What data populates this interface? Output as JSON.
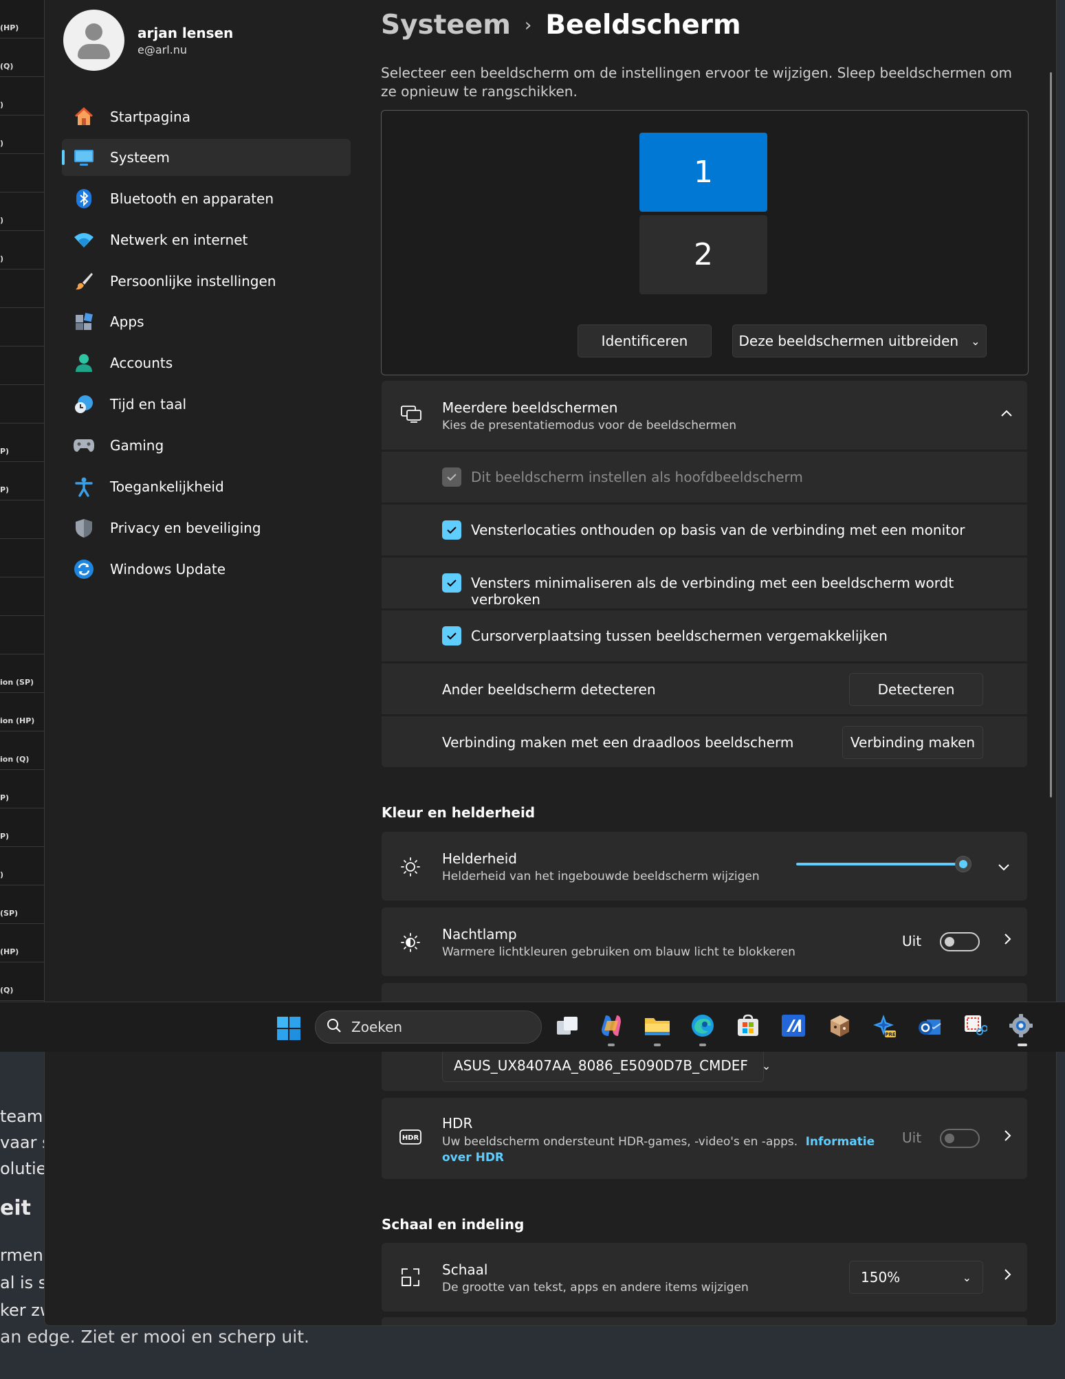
{
  "background": {
    "list_labels": [
      "(HP)",
      "(Q)",
      ")",
      ")",
      "",
      ")",
      ")",
      "",
      "",
      "",
      "",
      "P)",
      "P)",
      "",
      "",
      "",
      "",
      "ion (SP)",
      "ion (HP)",
      "ion (Q)",
      "P)",
      "P)",
      ")",
      "(SP)",
      "(HP)",
      "(Q)"
    ],
    "lines": [
      "team s",
      "vaar sp",
      "olutie",
      "eit",
      "rmen v",
      "al is sc",
      "ker zw"
    ],
    "edge_text": "an edge. Ziet er mooi en scherp uit."
  },
  "user": {
    "name": "arjan lensen",
    "email": "e@arl.nu"
  },
  "nav": [
    {
      "label": "Startpagina",
      "icon": "home-icon"
    },
    {
      "label": "Systeem",
      "icon": "system-icon",
      "active": true
    },
    {
      "label": "Bluetooth en apparaten",
      "icon": "bluetooth-icon"
    },
    {
      "label": "Netwerk en internet",
      "icon": "wifi-icon"
    },
    {
      "label": "Persoonlijke instellingen",
      "icon": "brush-icon"
    },
    {
      "label": "Apps",
      "icon": "apps-icon"
    },
    {
      "label": "Accounts",
      "icon": "accounts-icon"
    },
    {
      "label": "Tijd en taal",
      "icon": "time-language-icon"
    },
    {
      "label": "Gaming",
      "icon": "gamepad-icon"
    },
    {
      "label": "Toegankelijkheid",
      "icon": "accessibility-icon"
    },
    {
      "label": "Privacy en beveiliging",
      "icon": "shield-icon"
    },
    {
      "label": "Windows Update",
      "icon": "update-icon"
    }
  ],
  "breadcrumb": {
    "parent": "Systeem",
    "separator": "›",
    "current": "Beeldscherm"
  },
  "intro": "Selecteer een beeldscherm om de instellingen ervoor te wijzigen. Sleep beeldschermen om ze opnieuw te rangschikken.",
  "arrangement": {
    "monitors": [
      "1",
      "2"
    ],
    "identify_label": "Identificeren",
    "mode_label": "Deze beeldschermen uitbreiden"
  },
  "multiple": {
    "title": "Meerdere beeldschermen",
    "subtitle": "Kies de presentatiemodus voor de beeldschermen",
    "options": [
      {
        "label": "Dit beeldscherm instellen als hoofdbeeldscherm",
        "checked": true,
        "disabled": true
      },
      {
        "label": "Vensterlocaties onthouden op basis van de verbinding met een monitor",
        "checked": true
      },
      {
        "label": "Vensters minimaliseren als de verbinding met een beeldscherm wordt verbroken",
        "checked": true
      },
      {
        "label": "Cursorverplaatsing tussen beeldschermen vergemakkelijken",
        "checked": true
      }
    ],
    "detect_label": "Ander beeldscherm detecteren",
    "detect_button": "Detecteren",
    "wireless_label": "Verbinding maken met een draadloos beeldscherm",
    "wireless_button": "Verbinding maken"
  },
  "color_section": "Kleur en helderheid",
  "brightness": {
    "title": "Helderheid",
    "subtitle": "Helderheid van het ingebouwde beeldscherm wijzigen",
    "level": 1.0
  },
  "nightlight": {
    "title": "Nachtlamp",
    "subtitle": "Warmere lichtkleuren gebruiken om blauw licht te blokkeren",
    "state": "Uit",
    "on": false
  },
  "color_profile": {
    "value": "ASUS_UX8407AA_8086_E5090D7B_CMDEF"
  },
  "hdr": {
    "title": "HDR",
    "subtitle": "Uw beeldscherm ondersteunt HDR-games, -video's en -apps.",
    "link": "Informatie over HDR",
    "state": "Uit",
    "on": false
  },
  "scale_section": "Schaal en indeling",
  "scale": {
    "title": "Schaal",
    "subtitle": "De grootte van tekst, apps en andere items wijzigen",
    "value": "150%"
  },
  "taskbar": {
    "search_placeholder": "Zoeken",
    "apps": [
      "task-view-icon",
      "copilot-icon",
      "file-explorer-icon",
      "edge-icon",
      "store-icon",
      "app-icon",
      "dice-app-icon",
      "pre-app-icon",
      "outlook-icon",
      "snipping-tool-icon",
      "settings-icon"
    ]
  },
  "colors": {
    "accent": "#60cdff",
    "monitor_selected": "#0078d4",
    "background": "#202020",
    "card": "#2b2b2b"
  }
}
